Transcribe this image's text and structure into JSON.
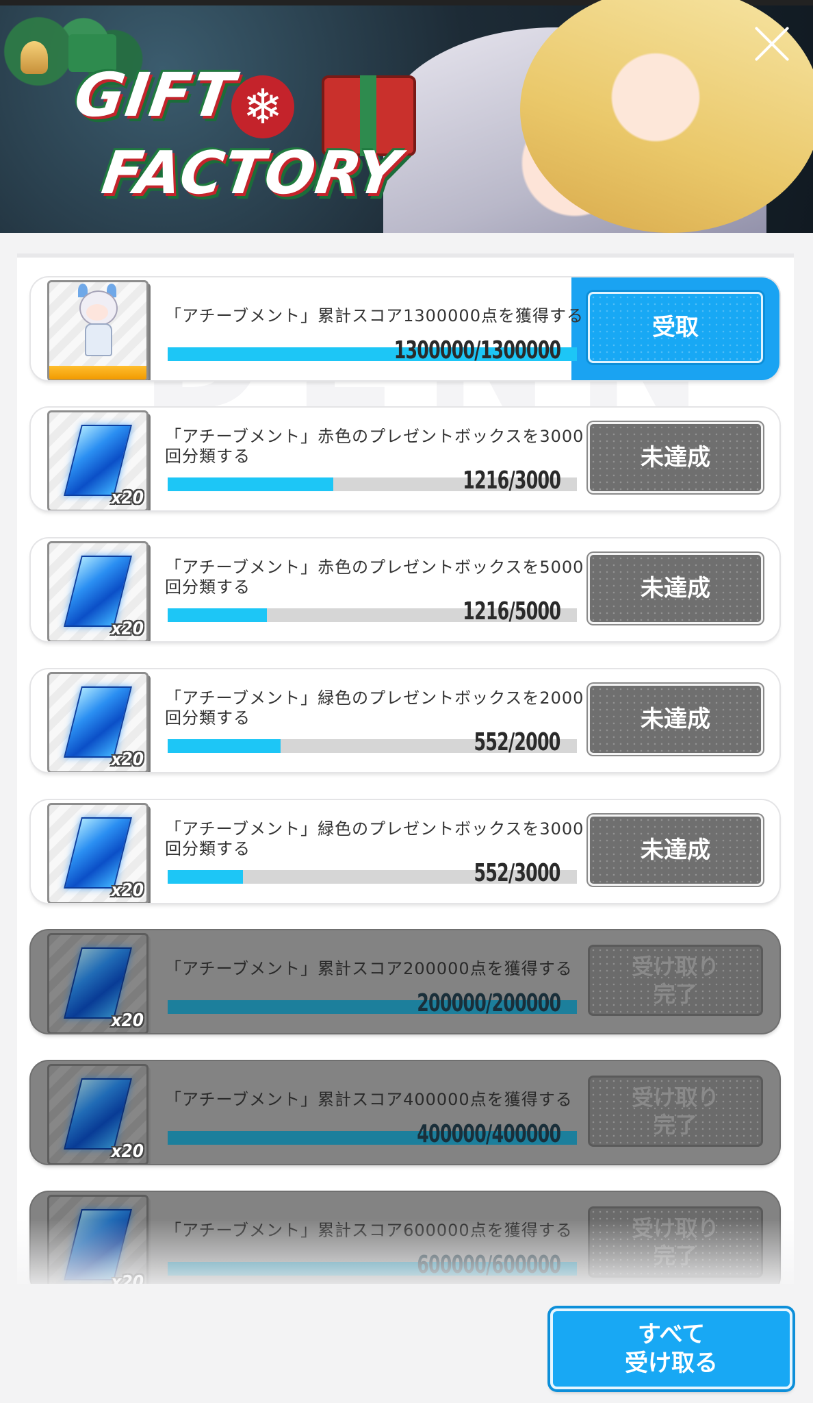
{
  "banner": {
    "title_line1": "GIFT",
    "title_line2": "FACTORY",
    "snowflake": "❄"
  },
  "items": [
    {
      "title": "「アチーブメント」累計スコア1300000点を獲得する",
      "progress": "1300000/1300000",
      "ratio": 1.0,
      "button": "受取",
      "state": "ready",
      "reward_qty": ""
    },
    {
      "title": "「アチーブメント」赤色のプレゼントボックスを3000回分類する",
      "progress": "1216/3000",
      "ratio": 0.405,
      "button": "未達成",
      "state": "pending",
      "reward_qty": "x20"
    },
    {
      "title": "「アチーブメント」赤色のプレゼントボックスを5000回分類する",
      "progress": "1216/5000",
      "ratio": 0.243,
      "button": "未達成",
      "state": "pending",
      "reward_qty": "x20"
    },
    {
      "title": "「アチーブメント」緑色のプレゼントボックスを2000回分類する",
      "progress": "552/2000",
      "ratio": 0.276,
      "button": "未達成",
      "state": "pending",
      "reward_qty": "x20"
    },
    {
      "title": "「アチーブメント」緑色のプレゼントボックスを3000回分類する",
      "progress": "552/3000",
      "ratio": 0.184,
      "button": "未達成",
      "state": "pending",
      "reward_qty": "x20"
    },
    {
      "title": "「アチーブメント」累計スコア200000点を獲得する",
      "progress": "200000/200000",
      "ratio": 1.0,
      "button": "受け取り完了",
      "state": "done",
      "reward_qty": "x20"
    },
    {
      "title": "「アチーブメント」累計スコア400000点を獲得する",
      "progress": "400000/400000",
      "ratio": 1.0,
      "button": "受け取り完了",
      "state": "done",
      "reward_qty": "x20"
    },
    {
      "title": "「アチーブメント」累計スコア600000点を獲得する",
      "progress": "600000/600000",
      "ratio": 1.0,
      "button": "受け取り完了",
      "state": "done",
      "reward_qty": "x20"
    }
  ],
  "footer": {
    "claim_all": "すべて\n受け取る"
  },
  "icons": {
    "close": "close-icon",
    "reward": "crystal-icon",
    "character": "character-icon"
  },
  "colors": {
    "accent": "#18a8f4",
    "progress_fill": "#1dc6f6",
    "pending_button": "#6f6f6f"
  }
}
